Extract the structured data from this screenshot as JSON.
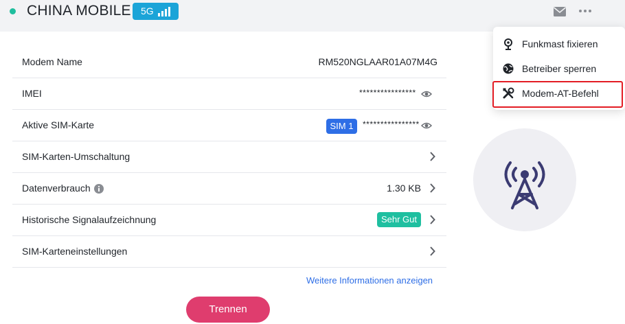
{
  "header": {
    "carrier": "CHINA MOBILE",
    "network_badge": "5G",
    "status_color": "#1fbe9e",
    "icons": [
      "mail-icon",
      "more-icon"
    ]
  },
  "panel": {
    "rows": [
      {
        "label": "Modem Name",
        "value": "RM520NGLAAR01A07M4G"
      },
      {
        "label": "IMEI",
        "value": "****************"
      },
      {
        "label": "Aktive SIM-Karte",
        "badge": "SIM 1",
        "value": "****************"
      },
      {
        "label": "SIM-Karten-Umschaltung"
      },
      {
        "label": "Datenverbrauch",
        "value": "1.30 KB"
      },
      {
        "label": "Historische Signalaufzeichnung",
        "badge": "Sehr Gut"
      },
      {
        "label": "SIM-Karteneinstellungen"
      }
    ],
    "more_link": "Weitere Informationen anzeigen",
    "disconnect_label": "Trennen"
  },
  "menu": {
    "items": [
      {
        "label": "Funkmast fixieren",
        "icon": "tower-pin-icon"
      },
      {
        "label": "Betreiber sperren",
        "icon": "globe-lock-icon"
      },
      {
        "label": "Modem-AT-Befehl",
        "icon": "tools-icon",
        "highlighted": true
      }
    ]
  },
  "colors": {
    "accent_blue": "#2e6ee6",
    "teal": "#1fbfa0",
    "danger_pink": "#df3d6e",
    "highlight_red": "#e31b23"
  }
}
